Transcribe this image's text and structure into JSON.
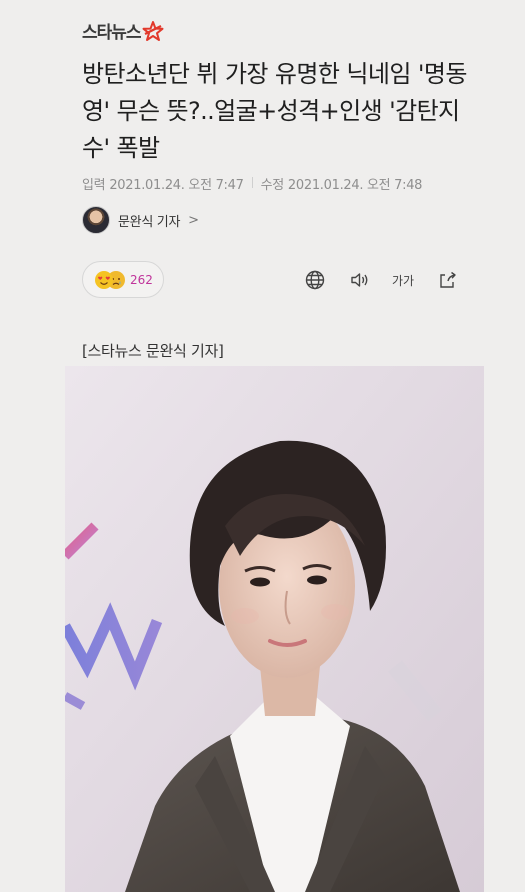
{
  "brand": {
    "name": "스타뉴스",
    "logo_icon": "star-logo-icon",
    "accent": "#e2382b"
  },
  "article": {
    "headline": "방탄소년단 뷔 가장 유명한 닉네임 '명동영' 무슨 뜻?..얼굴+성격+인생 '감탄지수' 폭발",
    "published_label": "입력",
    "published": "2021.01.24. 오전 7:47",
    "updated_label": "수정",
    "updated": "2021.01.24. 오전 7:48",
    "reporter": "문완식 기자",
    "reporter_chevron": ">",
    "photo_credit": "[스타뉴스 문완식 기자]"
  },
  "reactions": {
    "count": "262",
    "icons": [
      "heart-eyes-icon",
      "sad-face-icon"
    ],
    "count_color": "#c0359b"
  },
  "tools": {
    "font_size_label": "가가",
    "icons": [
      "globe-icon",
      "speaker-icon",
      "font-size-icon",
      "share-icon"
    ]
  }
}
